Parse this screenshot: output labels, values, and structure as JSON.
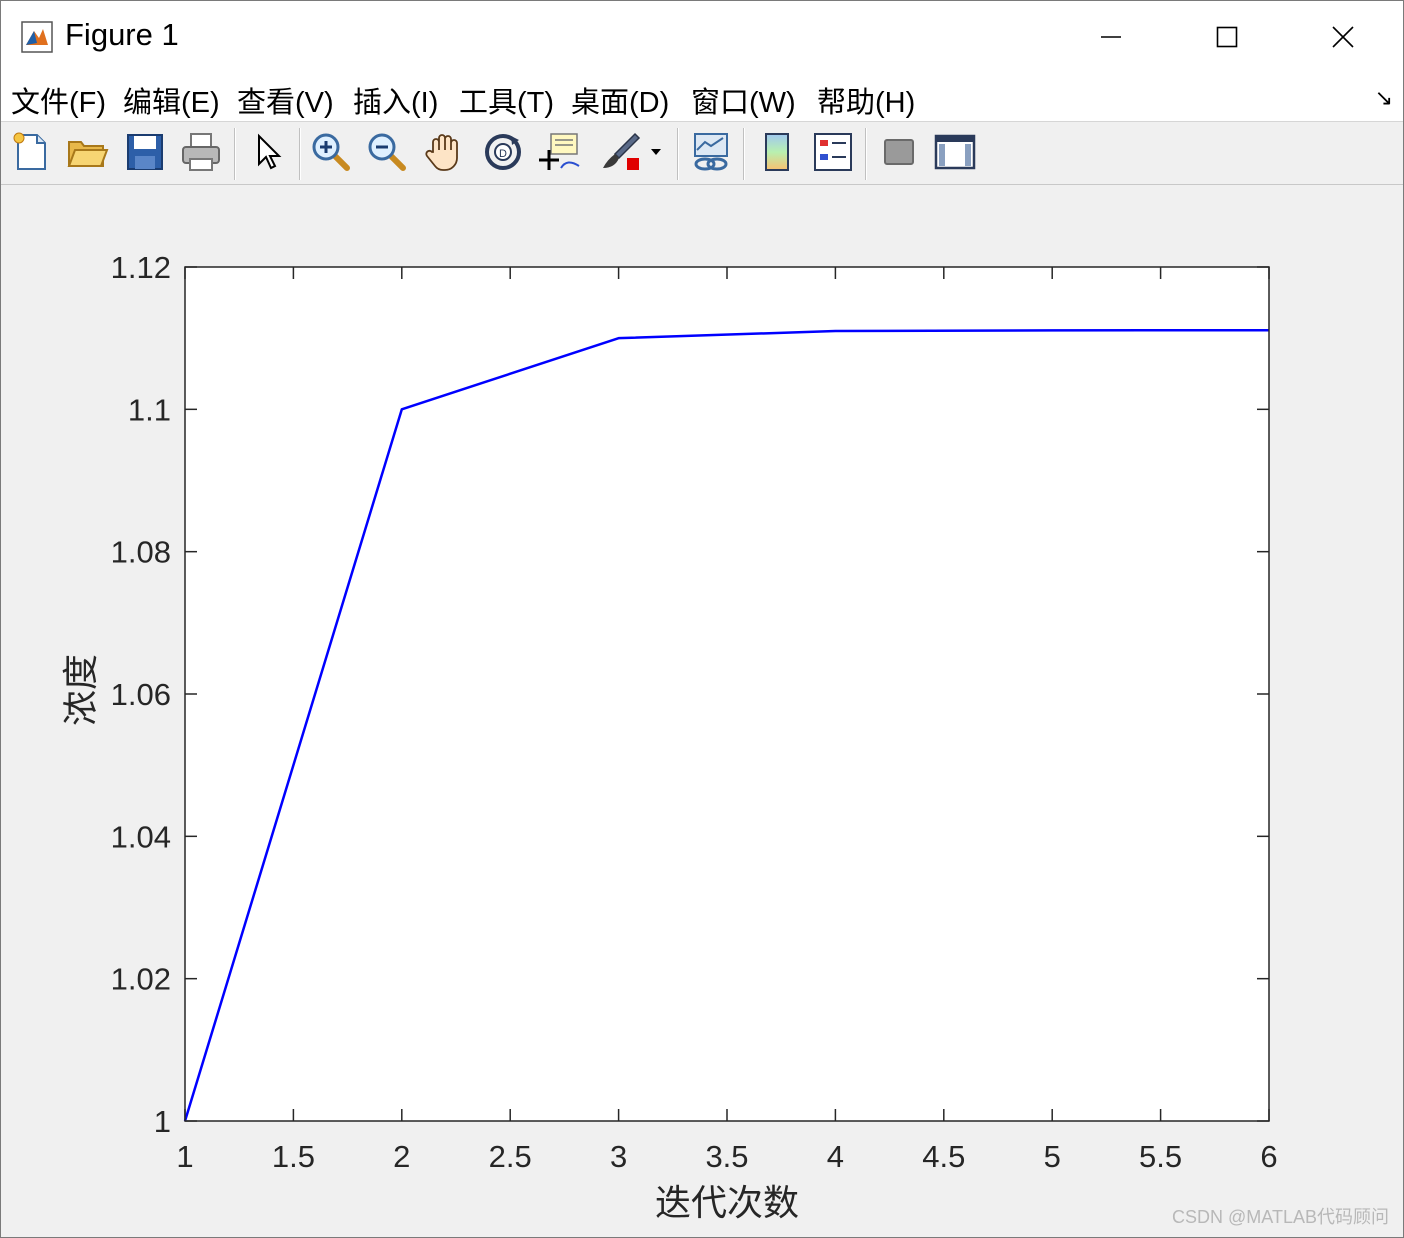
{
  "window": {
    "title": "Figure 1"
  },
  "menubar": {
    "items": [
      "文件(F)",
      "编辑(E)",
      "查看(V)",
      "插入(I)",
      "工具(T)",
      "桌面(D)",
      "窗口(W)",
      "帮助(H)"
    ]
  },
  "toolbar": {
    "buttons": [
      "new-figure",
      "open-file",
      "save-figure",
      "print-figure",
      "edit-plot-pointer",
      "zoom-in",
      "zoom-out",
      "pan-hand",
      "rotate-3d",
      "data-cursor",
      "brush",
      "link-plot",
      "insert-colorbar",
      "insert-legend",
      "hide-plot-tools",
      "show-plot-tools"
    ]
  },
  "chart_data": {
    "type": "line",
    "x": [
      1,
      2,
      3,
      4,
      5,
      6
    ],
    "series": [
      {
        "values": [
          1.0,
          1.1,
          1.11,
          1.111,
          1.1111,
          1.11111
        ],
        "color": "#0000ff"
      }
    ],
    "xlabel": "迭代次数",
    "ylabel": "浓度",
    "xlim": [
      1,
      6
    ],
    "ylim": [
      1,
      1.12
    ],
    "xticks": [
      "1",
      "1.5",
      "2",
      "2.5",
      "3",
      "3.5",
      "4",
      "4.5",
      "5",
      "5.5",
      "6"
    ],
    "yticks": [
      "1",
      "1.02",
      "1.04",
      "1.06",
      "1.08",
      "1.1",
      "1.12"
    ],
    "grid": false
  },
  "watermark": "CSDN @MATLAB代码顾问"
}
